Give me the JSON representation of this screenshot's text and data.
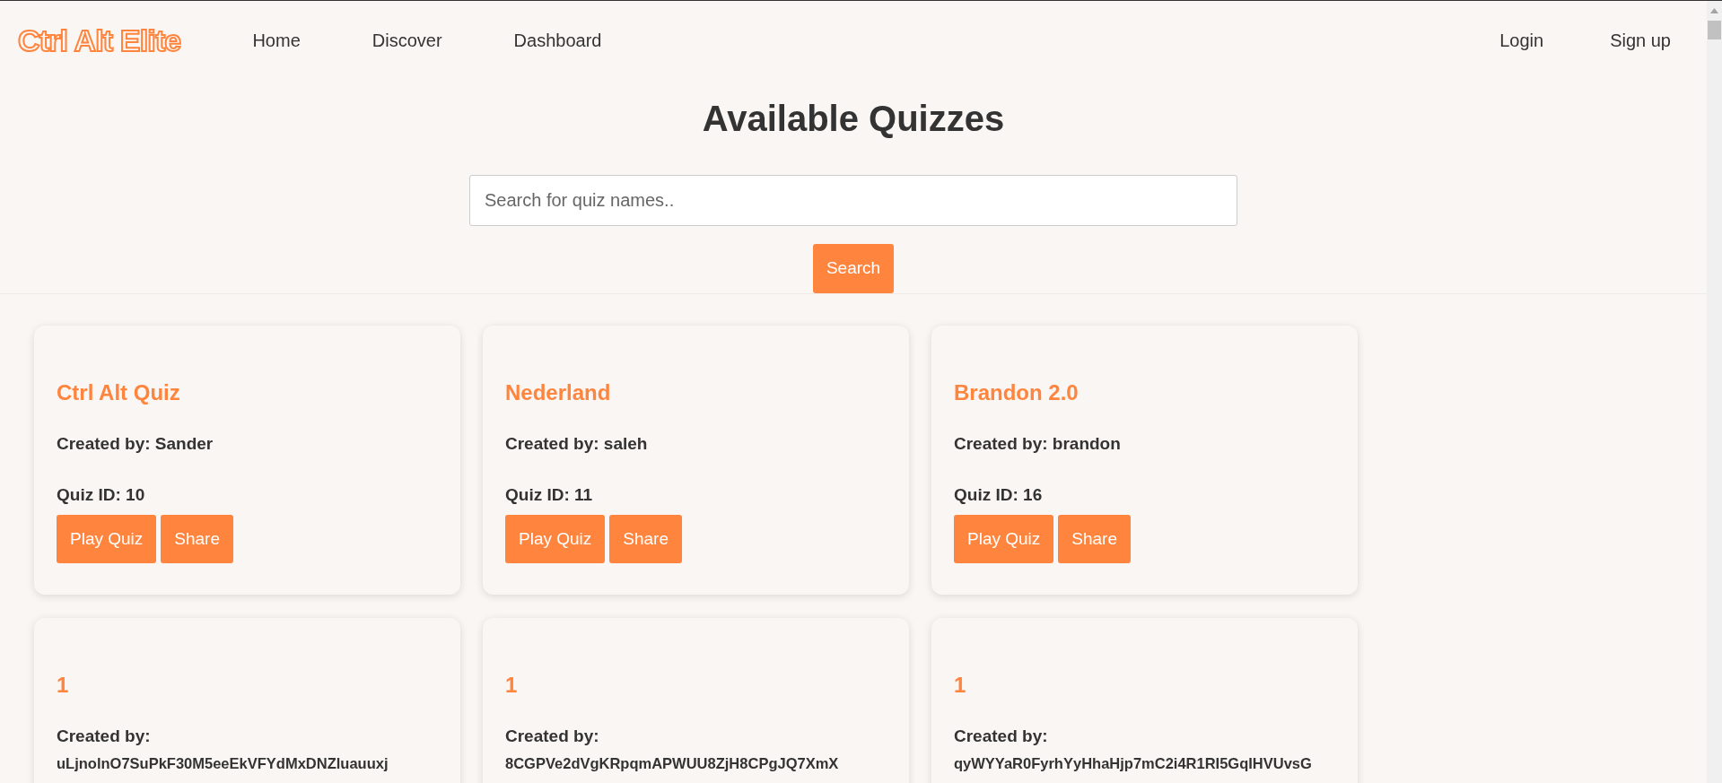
{
  "nav": {
    "logo": "Ctrl Alt Elite",
    "links": [
      "Home",
      "Discover",
      "Dashboard"
    ],
    "auth_links": [
      "Login",
      "Sign up"
    ]
  },
  "page_title": "Available Quizzes",
  "search": {
    "placeholder": "Search for quiz names..",
    "button": "Search"
  },
  "quizzes": [
    {
      "title": "Ctrl Alt Quiz",
      "creator_label": "Created by:",
      "creator": "Sander",
      "id_label": "Quiz ID:",
      "id": "10",
      "actions": [
        "Play Quiz",
        "Share"
      ]
    },
    {
      "title": "Nederland",
      "creator_label": "Created by:",
      "creator": "saleh",
      "id_label": "Quiz ID:",
      "id": "11",
      "actions": [
        "Play Quiz",
        "Share"
      ]
    },
    {
      "title": "Brandon 2.0",
      "creator_label": "Created by:",
      "creator": "brandon",
      "id_label": "Quiz ID:",
      "id": "16",
      "actions": [
        "Play Quiz",
        "Share"
      ]
    },
    {
      "title": "1",
      "creator_label": "Created by:",
      "creator": "uLjnolnO7SuPkF30M5eeEkVFYdMxDNZluauuxj"
    },
    {
      "title": "1",
      "creator_label": "Created by:",
      "creator": "8CGPVe2dVgKRpqmAPWUU8ZjH8CPgJQ7XmX"
    },
    {
      "title": "1",
      "creator_label": "Created by:",
      "creator": "qyWYYaR0FyrhYyHhaHjp7mC2i4R1RI5GqIHVUvsG"
    }
  ]
}
